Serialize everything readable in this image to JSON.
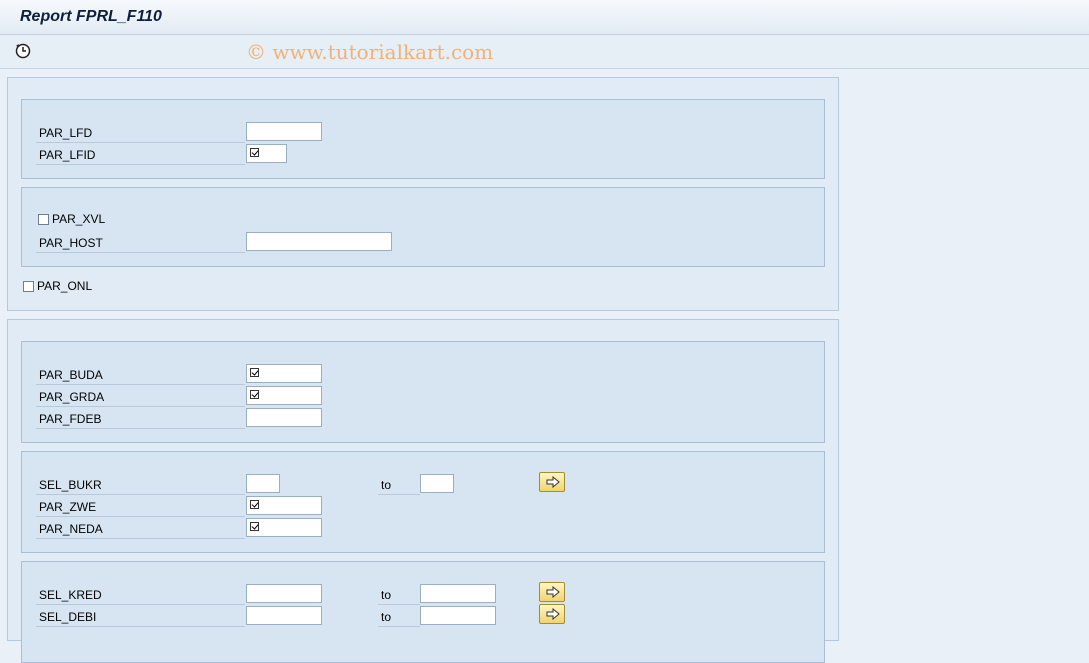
{
  "window": {
    "title": "Report FPRL_F110"
  },
  "toolbar": {
    "execute_icon": "execute-clock-icon"
  },
  "watermark": "© www.tutorialkart.com",
  "block1": {
    "group1": {
      "par_lfd": {
        "label": "PAR_LFD",
        "value": ""
      },
      "par_lfid": {
        "label": "PAR_LFID",
        "checked": true
      }
    },
    "group2": {
      "par_xvl": {
        "label": "PAR_XVL",
        "checked": false
      },
      "par_host": {
        "label": "PAR_HOST",
        "value": ""
      }
    },
    "par_onl": {
      "label": "PAR_ONL",
      "checked": false
    }
  },
  "block2": {
    "group1": {
      "par_buda": {
        "label": "PAR_BUDA",
        "checked": true
      },
      "par_grda": {
        "label": "PAR_GRDA",
        "checked": true
      },
      "par_fdeb": {
        "label": "PAR_FDEB",
        "value": ""
      }
    },
    "group2": {
      "sel_bukr": {
        "label": "SEL_BUKR",
        "from": "",
        "to_label": "to",
        "to": ""
      },
      "par_zwe": {
        "label": "PAR_ZWE",
        "checked": true
      },
      "par_neda": {
        "label": "PAR_NEDA",
        "checked": true
      }
    },
    "group3": {
      "sel_kred": {
        "label": "SEL_KRED",
        "from": "",
        "to_label": "to",
        "to": ""
      },
      "sel_debi": {
        "label": "SEL_DEBI",
        "from": "",
        "to_label": "to",
        "to": ""
      }
    }
  }
}
